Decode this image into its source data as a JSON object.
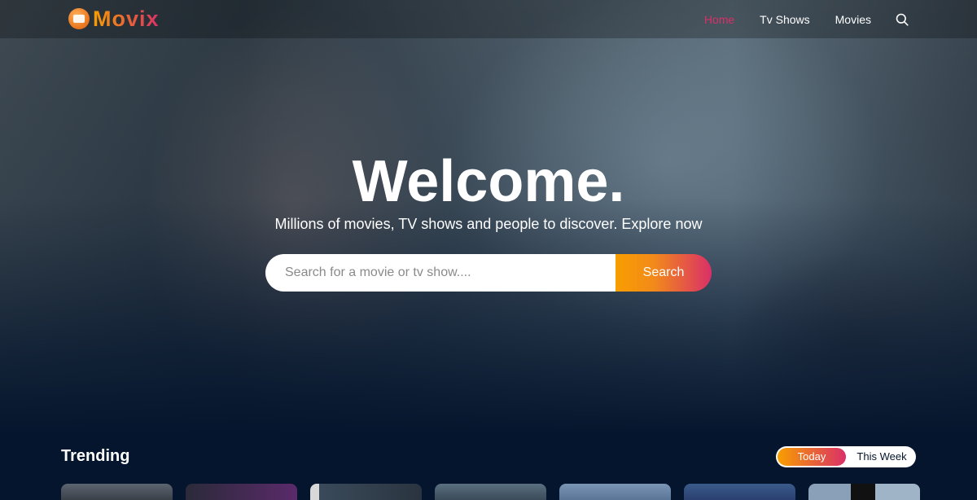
{
  "brand": {
    "name": "Movix"
  },
  "nav": {
    "items": [
      {
        "label": "Home",
        "active": true
      },
      {
        "label": "Tv Shows",
        "active": false
      },
      {
        "label": "Movies",
        "active": false
      }
    ],
    "search_icon": "search-icon"
  },
  "hero": {
    "title": "Welcome.",
    "subtitle": "Millions of movies, TV shows and people to discover. Explore now",
    "search": {
      "placeholder": "Search for a movie or tv show....",
      "value": "",
      "button_label": "Search"
    }
  },
  "trending": {
    "title": "Trending",
    "tabs": [
      {
        "label": "Today",
        "selected": true
      },
      {
        "label": "This Week",
        "selected": false
      }
    ]
  },
  "colors": {
    "accent_orange": "#f89e00",
    "accent_pink": "#da2f68",
    "background": "#04152d"
  }
}
